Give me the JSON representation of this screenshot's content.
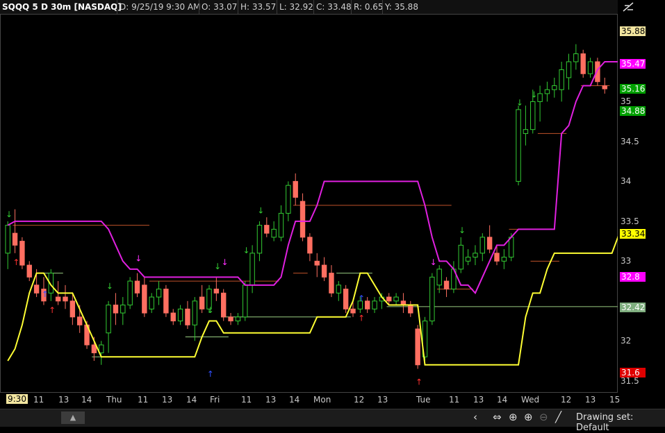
{
  "header": {
    "symbol": "SQQQ 5 D 30m [NASDAQ]",
    "date": "D: 9/25/19 9:30 AM",
    "open": "O: 33.07",
    "high": "H: 33.57",
    "low": "L: 32.92",
    "close": "C: 33.48",
    "range": "R: 0.65",
    "y": "Y: 35.88"
  },
  "price_axis": {
    "ticks": [
      "35",
      "34.5",
      "34",
      "33.5",
      "33",
      "32",
      "31.5"
    ],
    "labels": [
      {
        "text": "35.88",
        "bg": "#f3e6a0",
        "fg": "#000000"
      },
      {
        "text": "35.47",
        "bg": "#ff00ff",
        "fg": "#ffffff"
      },
      {
        "text": "35.16",
        "bg": "#00a000",
        "fg": "#ffffff"
      },
      {
        "text": "34.88",
        "bg": "#00a000",
        "fg": "#ffffff"
      },
      {
        "text": "33.34",
        "bg": "#ffff00",
        "fg": "#000000"
      },
      {
        "text": "32.8",
        "bg": "#ff00ff",
        "fg": "#ffffff"
      },
      {
        "text": "32.42",
        "bg": "#7fae7f",
        "fg": "#ffffff"
      },
      {
        "text": "31.6",
        "bg": "#e00000",
        "fg": "#ffffff"
      }
    ]
  },
  "time_axis": {
    "labels": [
      "9:30",
      "11",
      "13",
      "14",
      "Thu",
      "11",
      "13",
      "14",
      "Fri",
      "11",
      "13",
      "14",
      "Mon",
      "12",
      "13",
      "Tue",
      "11",
      "13",
      "14",
      "Wed",
      "12",
      "13",
      "15"
    ]
  },
  "bottom_bar": {
    "collapse_label": "▲",
    "drawing_set": "Drawing set: Default"
  },
  "colors": {
    "up": "#33cc33",
    "down": "#ff6f61",
    "magenta": "#e020e0",
    "yellow": "#ffff33",
    "orange_line": "#c0522a",
    "green_line": "#9acd82"
  },
  "chart_data": {
    "type": "candlestick",
    "ylim": [
      31.35,
      36.1
    ],
    "candles": [
      [
        33.1,
        33.5,
        32.9,
        33.45
      ],
      [
        33.35,
        33.65,
        33.1,
        33.2
      ],
      [
        33.25,
        33.3,
        32.9,
        32.95
      ],
      [
        32.95,
        33.0,
        32.75,
        32.8
      ],
      [
        32.7,
        32.9,
        32.55,
        32.6
      ],
      [
        32.65,
        32.8,
        32.45,
        32.5
      ],
      [
        32.6,
        32.9,
        32.5,
        32.85
      ],
      [
        32.55,
        32.75,
        32.45,
        32.5
      ],
      [
        32.55,
        32.7,
        32.4,
        32.5
      ],
      [
        32.5,
        32.6,
        32.2,
        32.3
      ],
      [
        32.3,
        32.45,
        32.1,
        32.2
      ],
      [
        32.2,
        32.25,
        31.9,
        31.95
      ],
      [
        31.95,
        32.05,
        31.75,
        31.85
      ],
      [
        31.85,
        32.0,
        31.7,
        31.95
      ],
      [
        32.1,
        32.5,
        31.85,
        32.45
      ],
      [
        32.45,
        32.6,
        32.2,
        32.35
      ],
      [
        32.35,
        32.55,
        32.2,
        32.45
      ],
      [
        32.45,
        32.8,
        32.4,
        32.75
      ],
      [
        32.75,
        32.85,
        32.55,
        32.6
      ],
      [
        32.7,
        32.8,
        32.3,
        32.35
      ],
      [
        32.4,
        32.6,
        32.35,
        32.55
      ],
      [
        32.55,
        32.75,
        32.45,
        32.65
      ],
      [
        32.65,
        32.7,
        32.3,
        32.35
      ],
      [
        32.35,
        32.4,
        32.2,
        32.25
      ],
      [
        32.25,
        32.45,
        32.2,
        32.4
      ],
      [
        32.4,
        32.5,
        32.15,
        32.2
      ],
      [
        32.2,
        32.55,
        32.0,
        32.5
      ],
      [
        32.55,
        32.7,
        32.35,
        32.4
      ],
      [
        32.4,
        32.7,
        32.35,
        32.65
      ],
      [
        32.65,
        32.8,
        32.5,
        32.6
      ],
      [
        32.6,
        32.65,
        32.25,
        32.3
      ],
      [
        32.3,
        32.35,
        32.2,
        32.25
      ],
      [
        32.25,
        32.35,
        32.2,
        32.3
      ],
      [
        32.3,
        32.75,
        32.25,
        32.7
      ],
      [
        32.7,
        33.2,
        32.6,
        33.1
      ],
      [
        33.1,
        33.5,
        33.0,
        33.45
      ],
      [
        33.45,
        33.55,
        33.3,
        33.35
      ],
      [
        33.3,
        33.5,
        33.25,
        33.4
      ],
      [
        33.3,
        33.7,
        33.25,
        33.6
      ],
      [
        33.6,
        34.0,
        33.5,
        33.95
      ],
      [
        34.0,
        34.1,
        33.7,
        33.8
      ],
      [
        33.75,
        33.85,
        33.25,
        33.3
      ],
      [
        33.3,
        33.35,
        33.0,
        33.1
      ],
      [
        33.0,
        33.1,
        32.8,
        32.95
      ],
      [
        32.95,
        33.05,
        32.75,
        32.8
      ],
      [
        32.85,
        32.95,
        32.55,
        32.6
      ],
      [
        32.6,
        32.75,
        32.5,
        32.7
      ],
      [
        32.65,
        32.7,
        32.35,
        32.4
      ],
      [
        32.4,
        32.5,
        32.3,
        32.35
      ],
      [
        32.4,
        32.55,
        32.35,
        32.5
      ],
      [
        32.5,
        32.55,
        32.35,
        32.4
      ],
      [
        32.4,
        32.55,
        32.35,
        32.5
      ],
      [
        32.5,
        32.6,
        32.4,
        32.55
      ],
      [
        32.55,
        32.6,
        32.45,
        32.5
      ],
      [
        32.5,
        32.6,
        32.45,
        32.55
      ],
      [
        32.5,
        32.6,
        32.35,
        32.45
      ],
      [
        32.45,
        32.5,
        32.3,
        32.35
      ],
      [
        32.15,
        32.2,
        31.65,
        31.7
      ],
      [
        31.8,
        32.3,
        31.75,
        32.25
      ],
      [
        32.25,
        32.85,
        32.2,
        32.8
      ],
      [
        32.7,
        32.95,
        32.6,
        32.9
      ],
      [
        32.75,
        32.8,
        32.55,
        32.65
      ],
      [
        32.65,
        33.0,
        32.6,
        32.9
      ],
      [
        32.9,
        33.3,
        32.85,
        33.2
      ],
      [
        33.0,
        33.15,
        32.95,
        33.05
      ],
      [
        33.05,
        33.2,
        32.95,
        33.1
      ],
      [
        33.1,
        33.35,
        33.0,
        33.3
      ],
      [
        33.3,
        33.45,
        33.1,
        33.15
      ],
      [
        33.1,
        33.2,
        32.95,
        33.0
      ],
      [
        33.0,
        33.15,
        32.9,
        33.05
      ],
      [
        33.05,
        33.35,
        33.0,
        33.3
      ],
      [
        34.0,
        34.95,
        33.95,
        34.9
      ],
      [
        34.6,
        34.95,
        34.45,
        34.65
      ],
      [
        34.65,
        35.15,
        34.6,
        35.0
      ],
      [
        35.0,
        35.2,
        34.75,
        35.1
      ],
      [
        35.1,
        35.25,
        35.0,
        35.15
      ],
      [
        35.15,
        35.3,
        35.05,
        35.2
      ],
      [
        35.15,
        35.5,
        35.0,
        35.4
      ],
      [
        35.3,
        35.6,
        35.15,
        35.5
      ],
      [
        35.5,
        35.72,
        35.4,
        35.6
      ],
      [
        35.6,
        35.65,
        35.3,
        35.35
      ],
      [
        35.35,
        35.55,
        35.3,
        35.5
      ],
      [
        35.5,
        35.55,
        35.2,
        35.25
      ],
      [
        35.2,
        35.3,
        35.1,
        35.16
      ]
    ],
    "series": [
      {
        "name": "",
        "values": [
          33.45,
          33.5,
          33.5,
          33.5,
          33.5,
          33.5,
          33.5,
          33.5,
          33.5,
          33.5,
          33.5,
          33.5,
          33.5,
          33.5,
          33.4,
          33.2,
          33.0,
          32.9,
          32.9,
          32.8,
          32.8,
          32.8,
          32.8,
          32.8,
          32.8,
          32.8,
          32.8,
          32.8,
          32.8,
          32.8,
          32.8,
          32.8,
          32.8,
          32.7,
          32.7,
          32.7,
          32.7,
          32.7,
          32.8,
          33.2,
          33.5,
          33.5,
          33.5,
          33.7,
          34.0,
          34.0,
          34.0,
          34.0,
          34.0,
          34.0,
          34.0,
          34.0,
          34.0,
          34.0,
          34.0,
          34.0,
          34.0,
          34.0,
          33.7,
          33.3,
          33.0,
          33.0,
          32.9,
          32.7,
          32.7,
          32.6,
          32.8,
          33.0,
          33.2,
          33.2,
          33.3,
          33.4,
          33.4,
          33.4,
          33.4,
          33.4,
          33.4,
          34.6,
          34.7,
          35.0,
          35.2,
          35.2,
          35.4,
          35.5,
          35.5,
          35.5
        ]
      },
      {
        "name": "",
        "values": [
          31.75,
          31.9,
          32.2,
          32.6,
          32.85,
          32.85,
          32.7,
          32.6,
          32.6,
          32.6,
          32.4,
          32.2,
          32.0,
          31.8,
          31.8,
          31.8,
          31.8,
          31.8,
          31.8,
          31.8,
          31.8,
          31.8,
          31.8,
          31.8,
          31.8,
          31.8,
          31.8,
          32.05,
          32.25,
          32.25,
          32.1,
          32.1,
          32.1,
          32.1,
          32.1,
          32.1,
          32.1,
          32.1,
          32.1,
          32.1,
          32.1,
          32.1,
          32.1,
          32.3,
          32.3,
          32.3,
          32.3,
          32.3,
          32.5,
          32.85,
          32.85,
          32.7,
          32.55,
          32.45,
          32.45,
          32.45,
          32.45,
          32.45,
          31.7,
          31.7,
          31.7,
          31.7,
          31.7,
          31.7,
          31.7,
          31.7,
          31.7,
          31.7,
          31.7,
          31.7,
          31.7,
          31.7,
          32.3,
          32.6,
          32.6,
          32.9,
          33.1,
          33.1,
          33.1,
          33.1,
          33.1,
          33.1,
          33.1,
          33.1,
          33.1,
          33.34
        ]
      }
    ]
  }
}
